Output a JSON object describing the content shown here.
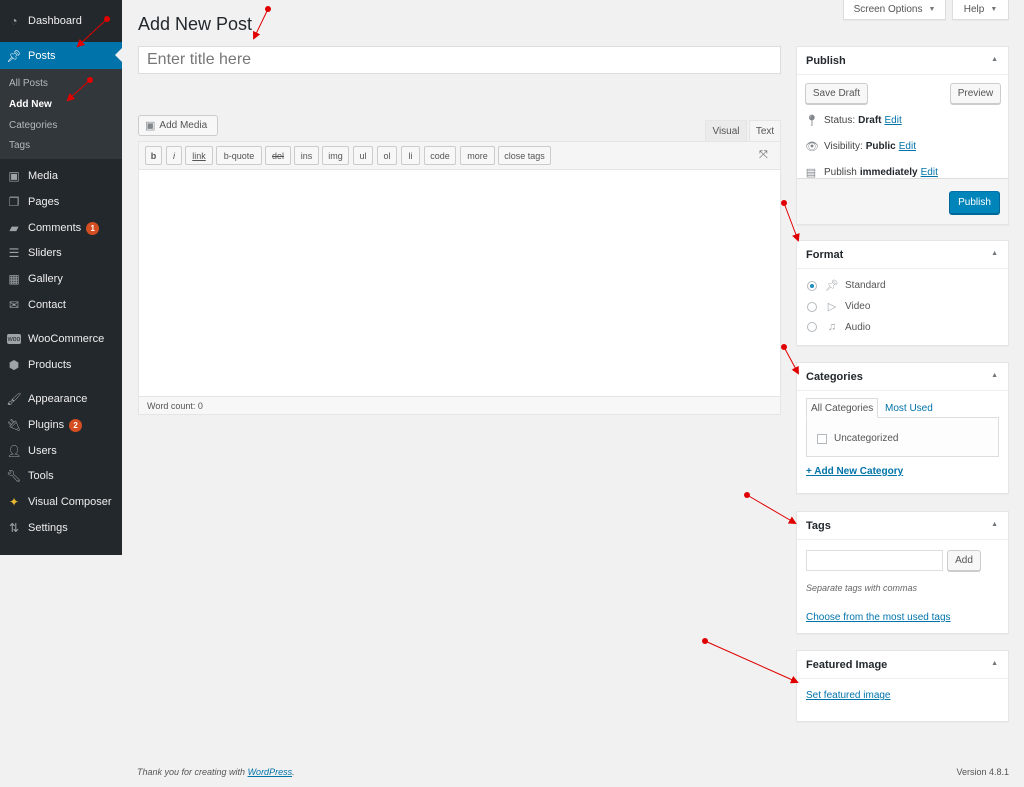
{
  "sidebar": {
    "items": [
      {
        "label": "Dashboard",
        "icon": "dashboard-icon"
      },
      {
        "label": "Posts",
        "icon": "pin-icon",
        "active": true
      },
      {
        "label": "Media",
        "icon": "media-icon"
      },
      {
        "label": "Pages",
        "icon": "pages-icon"
      },
      {
        "label": "Comments",
        "icon": "comment-icon",
        "badge": "1"
      },
      {
        "label": "Sliders",
        "icon": "sliders-icon"
      },
      {
        "label": "Gallery",
        "icon": "gallery-icon"
      },
      {
        "label": "Contact",
        "icon": "mail-icon"
      },
      {
        "label": "WooCommerce",
        "icon": "woo-icon"
      },
      {
        "label": "Products",
        "icon": "box-icon"
      },
      {
        "label": "Appearance",
        "icon": "brush-icon"
      },
      {
        "label": "Plugins",
        "icon": "plug-icon",
        "badge": "2"
      },
      {
        "label": "Users",
        "icon": "user-icon"
      },
      {
        "label": "Tools",
        "icon": "wrench-icon"
      },
      {
        "label": "Visual Composer",
        "icon": "vc-icon"
      },
      {
        "label": "Settings",
        "icon": "settings-icon"
      }
    ],
    "submenu": [
      {
        "label": "All Posts"
      },
      {
        "label": "Add New",
        "current": true
      },
      {
        "label": "Categories"
      },
      {
        "label": "Tags"
      }
    ]
  },
  "top": {
    "screen_options": "Screen Options",
    "help": "Help"
  },
  "page": {
    "title": "Add New Post",
    "title_placeholder": "Enter title here",
    "title_value": ""
  },
  "editor": {
    "add_media": "Add Media",
    "tabs": {
      "visual": "Visual",
      "text": "Text",
      "active": "Text"
    },
    "quicktags": [
      "b",
      "i",
      "link",
      "b-quote",
      "del",
      "ins",
      "img",
      "ul",
      "ol",
      "li",
      "code",
      "more",
      "close tags"
    ],
    "content": "",
    "word_count": "Word count: 0"
  },
  "publish": {
    "title": "Publish",
    "save_draft": "Save Draft",
    "preview": "Preview",
    "status_label": "Status:",
    "status_value": "Draft",
    "visibility_label": "Visibility:",
    "visibility_value": "Public",
    "publish_label": "Publish",
    "publish_value": "immediately",
    "edit": "Edit",
    "publish_button": "Publish"
  },
  "format": {
    "title": "Format",
    "options": [
      {
        "label": "Standard",
        "icon": "pin-icon",
        "checked": true
      },
      {
        "label": "Video",
        "icon": "video-icon",
        "checked": false
      },
      {
        "label": "Audio",
        "icon": "audio-icon",
        "checked": false
      }
    ]
  },
  "categories": {
    "title": "Categories",
    "tab_all": "All Categories",
    "tab_most_used": "Most Used",
    "items": [
      {
        "label": "Uncategorized",
        "checked": false
      }
    ],
    "add_new": "+ Add New Category"
  },
  "tags": {
    "title": "Tags",
    "input_value": "",
    "add": "Add",
    "hint": "Separate tags with commas",
    "choose_link": "Choose from the most used tags"
  },
  "featured_image": {
    "title": "Featured Image",
    "set_link": "Set featured image"
  },
  "footer": {
    "thanks_prefix": "Thank you for creating with ",
    "thanks_link": "WordPress",
    "thanks_suffix": ".",
    "version": "Version 4.8.1"
  },
  "colors": {
    "sidebar_bg": "#23282d",
    "active_menu": "#0073aa",
    "primary_button": "#0085ba",
    "badge": "#d54e21",
    "link": "#0073aa",
    "annotation_arrow": "#e00000"
  }
}
